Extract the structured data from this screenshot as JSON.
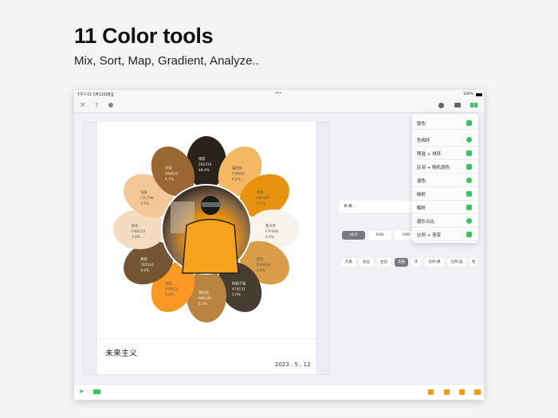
{
  "headline": "11 Color tools",
  "subline": "Mix, Sort, Map, Gradient, Analyze..",
  "status": {
    "time": "下午7:01  5月12日周五",
    "dots": "•••",
    "battery": "100%"
  },
  "card": {
    "caption": "未来主义",
    "date": "2023 . 5 . 12"
  },
  "palette_field": "青-橘",
  "formats": [
    "HEX",
    "RGB",
    "HSB"
  ],
  "active_format": 0,
  "chips": [
    "元素",
    "右边",
    "左边",
    "花瓣",
    "环",
    "比例:横",
    "比例:竖",
    "饱"
  ],
  "active_chip": 3,
  "menu": [
    {
      "label": "取色",
      "icon": "grid-icon"
    },
    {
      "label": "色相环",
      "icon": "wheel-icon"
    },
    {
      "label": "筛选 + 排序",
      "icon": "grid-icon"
    },
    {
      "label": "区间 + 随机调色",
      "icon": "copy-icon"
    },
    {
      "label": "混色",
      "icon": "half-circle-icon"
    },
    {
      "label": "映射",
      "icon": "layers-icon"
    },
    {
      "label": "解析",
      "icon": "doc-icon"
    },
    {
      "label": "扇形占比",
      "icon": "pie-icon"
    },
    {
      "label": "比例 + 渐变",
      "icon": "ratio-icon"
    }
  ],
  "colors": {
    "accent": "#34c759",
    "orange": "#f39c12",
    "bg": "#f0f0f5"
  },
  "petals": [
    {
      "name": "煤黑",
      "hex": "292319",
      "pct": "48.4%"
    },
    {
      "name": "蜜蜂色",
      "hex": "F4B862",
      "pct": "6.8%"
    },
    {
      "name": "金黄",
      "hex": "E8930F",
      "pct": "5.5%"
    },
    {
      "name": "象牙色",
      "hex": "F7F4EB",
      "pct": "4.8%"
    },
    {
      "name": "驼色",
      "hex": "DA9C48",
      "pct": "4.9%"
    },
    {
      "name": "棕榈子油",
      "hex": "473C31",
      "pct": "5.0%"
    },
    {
      "name": "黄棕色",
      "hex": "B8843F",
      "pct": "5.3%"
    },
    {
      "name": "杏红",
      "hex": "FA9823",
      "pct": "5.4%"
    },
    {
      "name": "栗棕",
      "hex": "745533",
      "pct": "4.0%"
    },
    {
      "name": "肤色",
      "hex": "F4DCC0",
      "pct": "3.8%"
    },
    {
      "name": "浅黄",
      "hex": "F3C796",
      "pct": "4.0%"
    },
    {
      "name": "乐棕",
      "hex": "9A6632",
      "pct": "4.7%"
    }
  ]
}
